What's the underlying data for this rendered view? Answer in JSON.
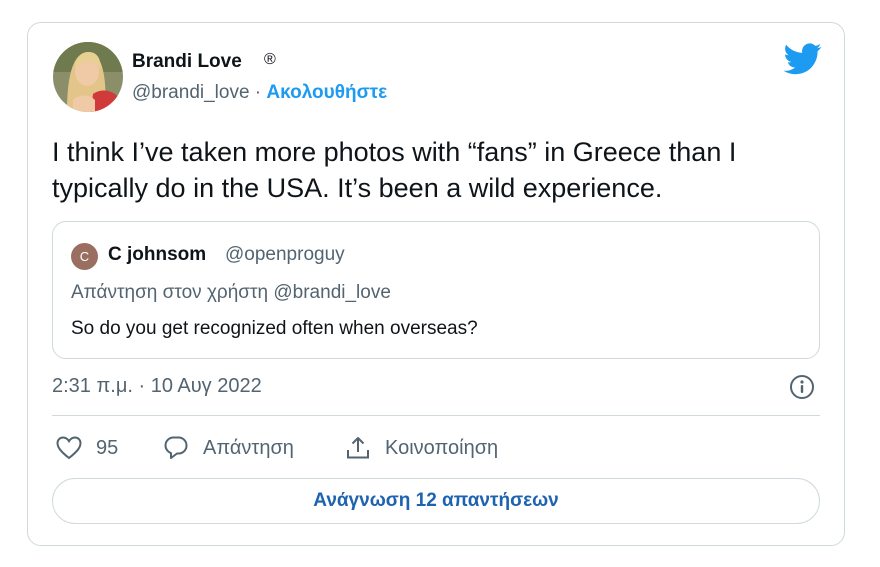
{
  "author": {
    "name": "Brandi Love",
    "badge": "®",
    "handle": "@brandi_love",
    "separator": " · ",
    "follow_label": "Ακολουθήστε"
  },
  "tweet": {
    "text": "I think I’ve taken more photos with “fans” in Greece than I typically do in the USA. It’s been a wild experience."
  },
  "quoted": {
    "avatar_initial": "C",
    "name": "C johnsom",
    "handle": "@openproguy",
    "reply_context": "Απάντηση στον χρήστη @brandi_love",
    "text": "So do you get recognized often when overseas?"
  },
  "timestamp": "2:31 π.μ. · 10 Αυγ 2022",
  "actions": {
    "like_count": "95",
    "reply_label": "Απάντηση",
    "share_label": "Κοινοποίηση"
  },
  "read_replies_label": "Ανάγνωση 12 απαντήσεων",
  "icons": {
    "brand": "twitter-bird-icon",
    "info": "info-icon",
    "like": "heart-icon",
    "reply": "reply-bubble-icon",
    "share": "share-icon"
  },
  "colors": {
    "accent": "#1d9bf0",
    "link": "#1d63b0",
    "text": "#0f1419",
    "muted": "#536471",
    "border": "#cfd9de"
  }
}
